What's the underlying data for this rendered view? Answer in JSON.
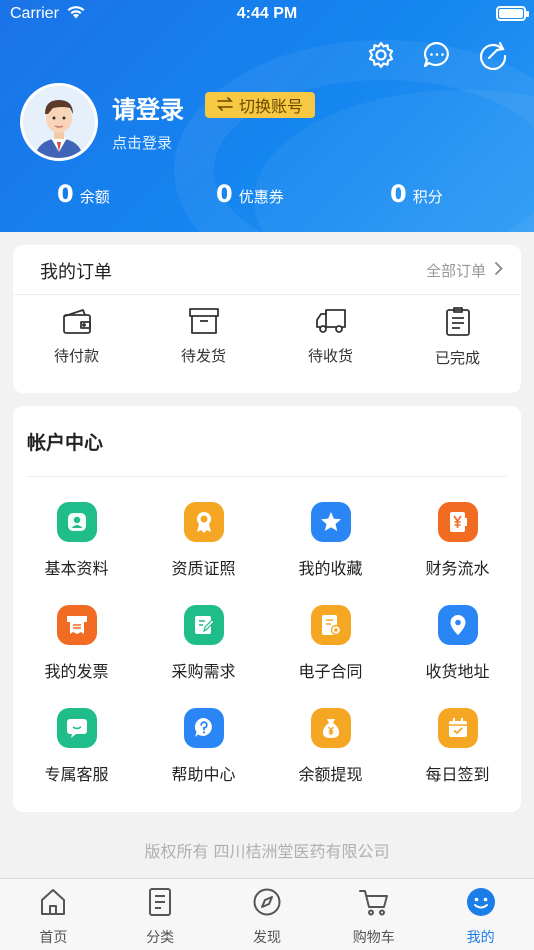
{
  "status_bar": {
    "carrier": "Carrier",
    "time": "4:44 PM"
  },
  "header": {
    "top_icons": [
      "gear-icon",
      "message-icon",
      "refresh-icon"
    ],
    "login_title": "请登录",
    "switch_account": "切换账号",
    "login_subtitle": "点击登录"
  },
  "stats": [
    {
      "value": "0",
      "label": "余额"
    },
    {
      "value": "0",
      "label": "优惠券"
    },
    {
      "value": "0",
      "label": "积分"
    }
  ],
  "orders": {
    "title": "我的订单",
    "all_label": "全部订单",
    "items": [
      {
        "label": "待付款",
        "icon": "wallet-icon"
      },
      {
        "label": "待发货",
        "icon": "box-icon"
      },
      {
        "label": "待收货",
        "icon": "truck-icon"
      },
      {
        "label": "已完成",
        "icon": "clipboard-icon"
      }
    ]
  },
  "account": {
    "title": "帐户中心",
    "items": [
      {
        "label": "基本资料",
        "icon": "user-icon",
        "color": "#1fbd8a"
      },
      {
        "label": "资质证照",
        "icon": "award-icon",
        "color": "#f5a623"
      },
      {
        "label": "我的收藏",
        "icon": "star-icon",
        "color": "#2a86f5"
      },
      {
        "label": "财务流水",
        "icon": "yen-icon",
        "color": "#f26b22"
      },
      {
        "label": "我的发票",
        "icon": "invoice-icon",
        "color": "#f26b22"
      },
      {
        "label": "采购需求",
        "icon": "edit-icon",
        "color": "#1fbd8a"
      },
      {
        "label": "电子合同",
        "icon": "contract-icon",
        "color": "#f5a623"
      },
      {
        "label": "收货地址",
        "icon": "location-icon",
        "color": "#2a86f5"
      },
      {
        "label": "专属客服",
        "icon": "chat-icon",
        "color": "#1fbd8a"
      },
      {
        "label": "帮助中心",
        "icon": "help-icon",
        "color": "#2a86f5"
      },
      {
        "label": "余额提现",
        "icon": "money-bag-icon",
        "color": "#f5a623"
      },
      {
        "label": "每日签到",
        "icon": "calendar-check-icon",
        "color": "#f5a623"
      }
    ]
  },
  "copyright": "版权所有 四川桔洲堂医药有限公司",
  "tabbar": [
    {
      "label": "首页",
      "icon": "home-icon"
    },
    {
      "label": "分类",
      "icon": "list-icon"
    },
    {
      "label": "发现",
      "icon": "compass-icon"
    },
    {
      "label": "购物车",
      "icon": "cart-icon"
    },
    {
      "label": "我的",
      "icon": "smile-icon"
    }
  ],
  "colors": {
    "brand_blue": "#1a7de8",
    "switch_yellow": "#f7c842"
  }
}
